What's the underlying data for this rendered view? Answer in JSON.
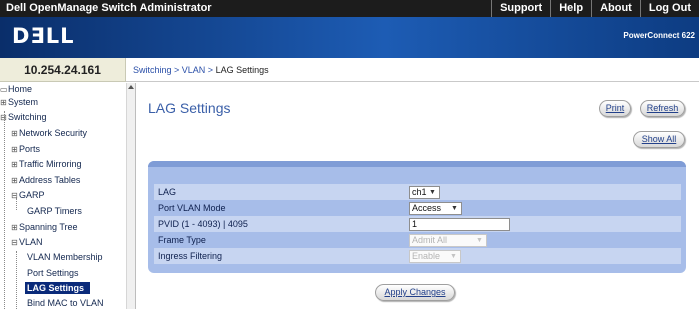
{
  "topbar": {
    "title": "Dell OpenManage Switch Administrator",
    "links": [
      "Support",
      "Help",
      "About",
      "Log Out"
    ]
  },
  "banner": {
    "logo": "DƎLL",
    "product": "PowerConnect 622"
  },
  "ip_address": "10.254.24.161",
  "breadcrumb": {
    "link": "Switching > VLAN >",
    "current": "LAG Settings"
  },
  "sidebar": {
    "items": [
      {
        "label": "Home",
        "icon": "home-icon"
      },
      {
        "label": "System",
        "icon": "expand-icon"
      },
      {
        "label": "Switching",
        "icon": "collapse-icon"
      },
      {
        "label": "Network Security",
        "icon": "expand-icon"
      },
      {
        "label": "Ports",
        "icon": "expand-icon"
      },
      {
        "label": "Traffic Mirroring",
        "icon": "expand-icon"
      },
      {
        "label": "Address Tables",
        "icon": "expand-icon"
      },
      {
        "label": "GARP",
        "icon": "collapse-icon"
      },
      {
        "label": "GARP Timers",
        "icon": ""
      },
      {
        "label": "Spanning Tree",
        "icon": "expand-icon"
      },
      {
        "label": "VLAN",
        "icon": "collapse-icon"
      },
      {
        "label": "VLAN Membership",
        "icon": ""
      },
      {
        "label": "Port Settings",
        "icon": ""
      },
      {
        "label": "LAG Settings",
        "icon": ""
      },
      {
        "label": "Bind MAC to VLAN",
        "icon": ""
      }
    ],
    "selected": "LAG Settings"
  },
  "main": {
    "title": "LAG Settings",
    "buttons": {
      "print": "Print",
      "refresh": "Refresh",
      "show_all": "Show All",
      "apply": "Apply Changes"
    },
    "fields": [
      {
        "label": "LAG",
        "value": "ch1",
        "type": "select",
        "enabled": true
      },
      {
        "label": "Port VLAN Mode",
        "value": "Access",
        "type": "select",
        "enabled": true
      },
      {
        "label": "PVID  (1 - 4093) | 4095",
        "value": "1",
        "type": "input",
        "enabled": true
      },
      {
        "label": "Frame Type",
        "value": "Admit All",
        "type": "select",
        "enabled": false
      },
      {
        "label": "Ingress Filtering",
        "value": "Enable",
        "type": "select",
        "enabled": false
      }
    ]
  },
  "colors": {
    "banner": "#1d5cb4",
    "panel": "#a7bde9",
    "selected_nav": "#0a2a7a",
    "title": "#3a5fa8"
  }
}
